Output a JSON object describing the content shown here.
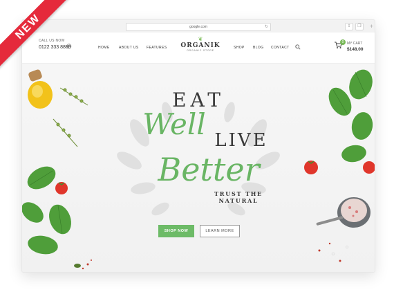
{
  "browser": {
    "url": "google.com",
    "reload_glyph": "↻",
    "share_glyph": "⇪",
    "tabs_glyph": "❐",
    "add_glyph": "+"
  },
  "ribbon": {
    "label": "NEW",
    "color": "#e52a3b"
  },
  "header": {
    "call_label": "CALL US NOW",
    "phone": "0122 333 8889",
    "nav": [
      "HOME",
      "ABOUT US",
      "FEATURES",
      "SHOP",
      "BLOG",
      "CONTACT"
    ],
    "logo_name": "ORGANIK",
    "logo_tagline": "ORGANIC STORE",
    "cart_label": "MY CART",
    "cart_total": "$148.00",
    "cart_count": "0"
  },
  "hero": {
    "line1": "EAT",
    "line2": "Well",
    "line3": "LIVE",
    "line4": "Better",
    "tagline": "TRUST THE NATURAL",
    "primary_button": "SHOP NOW",
    "secondary_button": "LEARN MORE"
  },
  "icons": {
    "phone": "phone-icon",
    "search": "search-icon",
    "cart": "cart-icon",
    "logo_leaf": "leaf-icon"
  },
  "colors": {
    "accent_green": "#6dbb67",
    "text_dark": "#3a3a3a",
    "ribbon_red": "#e52a3b"
  }
}
